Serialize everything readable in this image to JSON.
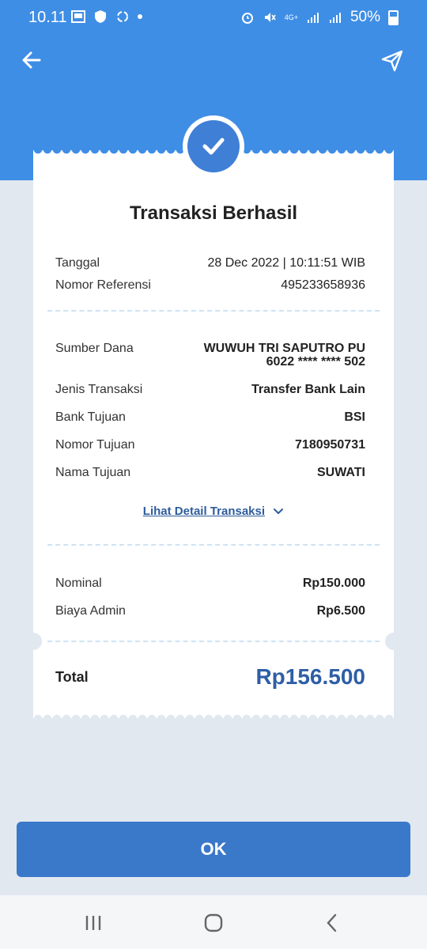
{
  "status_bar": {
    "time": "10.11",
    "battery": "50%",
    "network": "4G+"
  },
  "header": {
    "back_icon": "arrow-left-icon",
    "share_icon": "send-icon"
  },
  "receipt": {
    "title": "Transaksi Berhasil",
    "meta": [
      {
        "label": "Tanggal",
        "value": "28 Dec 2022 | 10:11:51 WIB"
      },
      {
        "label": "Nomor Referensi",
        "value": "495233658936"
      }
    ],
    "source": {
      "label": "Sumber Dana",
      "name": "WUWUH TRI SAPUTRO PU",
      "account": "6022 **** **** 502"
    },
    "details": [
      {
        "label": "Jenis Transaksi",
        "value": "Transfer Bank Lain"
      },
      {
        "label": "Bank Tujuan",
        "value": "BSI"
      },
      {
        "label": "Nomor Tujuan",
        "value": "7180950731"
      },
      {
        "label": "Nama Tujuan",
        "value": "SUWATI"
      }
    ],
    "detail_link": "Lihat Detail Transaksi",
    "amounts": [
      {
        "label": "Nominal",
        "value": "Rp150.000"
      },
      {
        "label": "Biaya Admin",
        "value": "Rp6.500"
      }
    ],
    "total": {
      "label": "Total",
      "value": "Rp156.500"
    }
  },
  "ok_button": "OK",
  "colors": {
    "header": "#3f8ee5",
    "accent": "#3a78c9",
    "total": "#2e5ea6"
  }
}
